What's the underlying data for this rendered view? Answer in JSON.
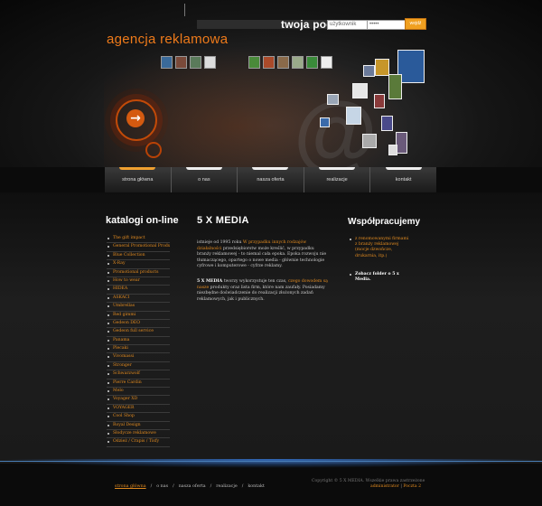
{
  "header": {
    "brand": "agencja reklamowa",
    "mail_label": "twoja  poczta",
    "login_placeholder": "użytkownik",
    "password_value": "•••••",
    "submit_label": "wejdź",
    "accent": "#ee7a1a"
  },
  "nav": {
    "items": [
      {
        "label": "strona główna",
        "active": true
      },
      {
        "label": "o nas",
        "active": false
      },
      {
        "label": "nasza oferta",
        "active": false
      },
      {
        "label": "realizacje",
        "active": false
      },
      {
        "label": "kontakt",
        "active": false
      }
    ]
  },
  "catalog": {
    "title": "katalogi on-line",
    "items": [
      "The gift impact",
      "General Promotional Products",
      "Blue Collection",
      "X-Ray",
      "Promotional products",
      "How to wear",
      "HIDEA",
      "ASKACI",
      "Umbrellas",
      "Red gimmi",
      "Gedeon DEO",
      "Gedeon full service",
      "Panama",
      "Plecaki",
      "Vivomassi",
      "Stronger",
      "Schwarzwolf",
      "Pierre Cardin",
      "Melo",
      "Voyager XD",
      "VOYAGER",
      "Cool Shop",
      "Royal Design",
      "Słodycze reklamowe",
      "Odzież / Crapis / Tisfy"
    ]
  },
  "main": {
    "title": "5 X MEDIA",
    "p1_a": "istnieje od 1995 roku ",
    "p1_hl": "W przypadku innych rodzajów działalności",
    "p1_b": " przedsiębiorstw może kreślić, w przypadku branży reklamowej - to niemal cała epoka. Epoka rozwoju nie tłumaczącego, opartego o nowe media - głównie technologie cyfrowe i komputerowe - cyfrze reklamy.",
    "p2_bold": "5 X MEDIA",
    "p2_a": " tworzy wykorzystuje ten czas, ",
    "p2_hl": "czego dowodem są nasze",
    "p2_b": " produkty oraz lista firm, które nam zaufały. Posiadamy niezbędne doświadczenie do realizacji złożonych zadań reklamowych, jak i publicznych."
  },
  "partners": {
    "title": "Współpracujemy",
    "item1": "z renomowanymi firmami z branży reklamowej (mocje dzwończe, drukarnia, itp.)",
    "item2": "Zobacz folder o 5 x Media."
  },
  "footer": {
    "copyright": "Copyright © 5 X MEDIA. Wszelkie prawa zastrzeżone",
    "admin_link": "administrator",
    "mail_link": "Poczta 2",
    "separator": "|",
    "nav": [
      "strona główna",
      "o nas",
      "nasza oferta",
      "realizacje",
      "kontakt"
    ]
  }
}
